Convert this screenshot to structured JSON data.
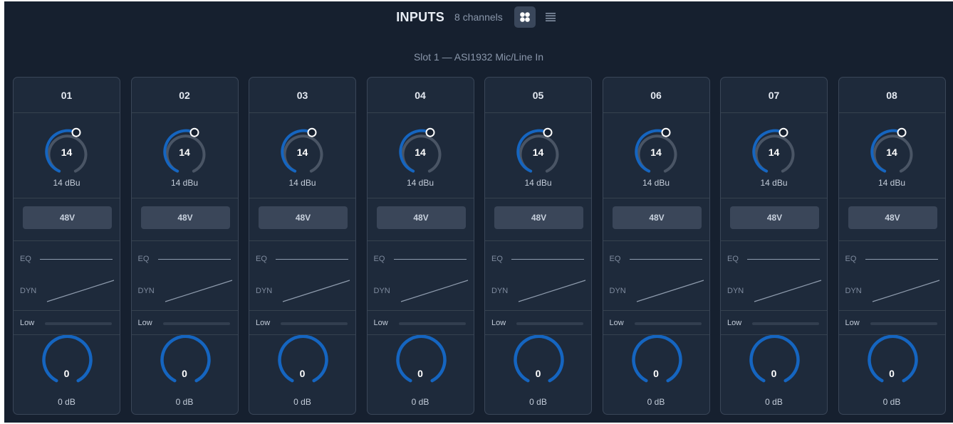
{
  "header": {
    "title": "INPUTS",
    "channel_count": "8 channels",
    "view_grid_icon": "grid-view-icon",
    "view_list_icon": "list-view-icon"
  },
  "slot_label": "Slot 1 — ASI1932 Mic/Line In",
  "colors": {
    "background": "#16202f",
    "strip": "#1e2a3b",
    "accent": "#1565c0",
    "track": "#4a5565"
  },
  "channels": [
    {
      "number": "01",
      "gain_value": "14",
      "gain_unit": "14 dBu",
      "phantom": "48V",
      "eq_label": "EQ",
      "dyn_label": "DYN",
      "low_label": "Low",
      "fader_value": "0",
      "fader_unit": "0 dB"
    },
    {
      "number": "02",
      "gain_value": "14",
      "gain_unit": "14 dBu",
      "phantom": "48V",
      "eq_label": "EQ",
      "dyn_label": "DYN",
      "low_label": "Low",
      "fader_value": "0",
      "fader_unit": "0 dB"
    },
    {
      "number": "03",
      "gain_value": "14",
      "gain_unit": "14 dBu",
      "phantom": "48V",
      "eq_label": "EQ",
      "dyn_label": "DYN",
      "low_label": "Low",
      "fader_value": "0",
      "fader_unit": "0 dB"
    },
    {
      "number": "04",
      "gain_value": "14",
      "gain_unit": "14 dBu",
      "phantom": "48V",
      "eq_label": "EQ",
      "dyn_label": "DYN",
      "low_label": "Low",
      "fader_value": "0",
      "fader_unit": "0 dB"
    },
    {
      "number": "05",
      "gain_value": "14",
      "gain_unit": "14 dBu",
      "phantom": "48V",
      "eq_label": "EQ",
      "dyn_label": "DYN",
      "low_label": "Low",
      "fader_value": "0",
      "fader_unit": "0 dB"
    },
    {
      "number": "06",
      "gain_value": "14",
      "gain_unit": "14 dBu",
      "phantom": "48V",
      "eq_label": "EQ",
      "dyn_label": "DYN",
      "low_label": "Low",
      "fader_value": "0",
      "fader_unit": "0 dB"
    },
    {
      "number": "07",
      "gain_value": "14",
      "gain_unit": "14 dBu",
      "phantom": "48V",
      "eq_label": "EQ",
      "dyn_label": "DYN",
      "low_label": "Low",
      "fader_value": "0",
      "fader_unit": "0 dB"
    },
    {
      "number": "08",
      "gain_value": "14",
      "gain_unit": "14 dBu",
      "phantom": "48V",
      "eq_label": "EQ",
      "dyn_label": "DYN",
      "low_label": "Low",
      "fader_value": "0",
      "fader_unit": "0 dB"
    }
  ]
}
